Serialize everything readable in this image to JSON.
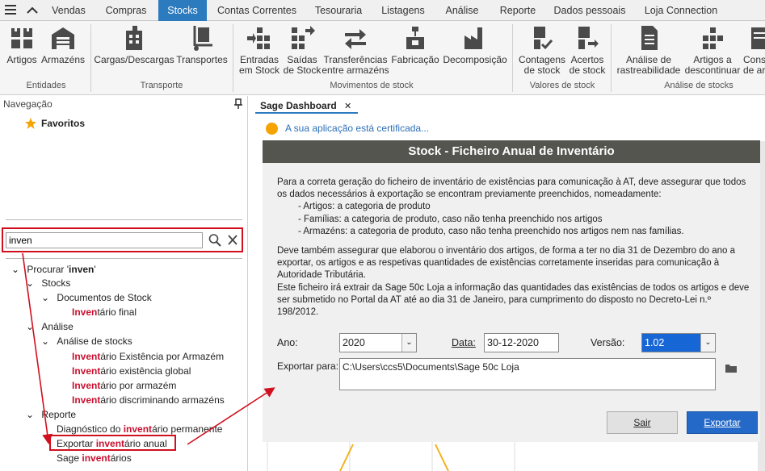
{
  "menu": {
    "tabs": [
      "Vendas",
      "Compras",
      "Stocks",
      "Contas Correntes",
      "Tesouraria",
      "Listagens",
      "Análise",
      "Reporte",
      "Dados pessoais",
      "Loja Connection"
    ],
    "active": "Stocks"
  },
  "ribbon": {
    "buttons": {
      "artigos": "Artigos",
      "armazens": "Armazéns",
      "cargas": "Cargas/Descargas",
      "transportes": "Transportes",
      "entradas_1": "Entradas",
      "entradas_2": "em Stock",
      "saidas_1": "Saídas",
      "saidas_2": "de Stock",
      "transf_1": "Transferências",
      "transf_2": "entre armazéns",
      "fabricacao": "Fabricação",
      "decomposicao": "Decomposição",
      "contagens_1": "Contagens",
      "contagens_2": "de stock",
      "acertos_1": "Acertos",
      "acertos_2": "de stock",
      "analise_1": "Análise de",
      "analise_2": "rastreabilidade",
      "descont_1": "Artigos a",
      "descont_2": "descontinuar",
      "cons_1": "Cons",
      "cons_2": "de ar"
    },
    "groups": {
      "entidades": "Entidades",
      "transporte": "Transporte",
      "movimentos": "Movimentos de stock",
      "valores": "Valores de stock",
      "analise": "Análise de stocks"
    }
  },
  "nav": {
    "header": "Navegação",
    "favoritos": "Favoritos",
    "search_value": "inven",
    "tree": {
      "root_prefix": "Procurar '",
      "root_query": "inven",
      "root_suffix": "'",
      "stocks": "Stocks",
      "doc_stock": "Documentos de Stock",
      "inv_final_hl": "Inven",
      "inv_final_rest": "tário final",
      "analise": "Análise",
      "analise_stocks": "Análise de stocks",
      "inv_exist_arm_hl": "Invent",
      "inv_exist_arm_rest": "ário Existência por Armazém",
      "inv_exist_glob_hl": "Invent",
      "inv_exist_glob_rest": "ário existência global",
      "inv_por_arm_hl": "Invent",
      "inv_por_arm_rest": "ário por armazém",
      "inv_discr_hl": "Invent",
      "inv_discr_rest": "ário discriminando armazéns",
      "reporte": "Reporte",
      "diag_pre": "Diagnóstico do ",
      "diag_hl": "invent",
      "diag_post": "ário permanente",
      "exp_pre": "Exportar ",
      "exp_hl": "invent",
      "exp_post": "ário anual",
      "sage_pre": "Sage ",
      "sage_hl": "invent",
      "sage_post": "ários"
    }
  },
  "doc_tab": {
    "label": "Sage Dashboard",
    "close": "✕"
  },
  "cert_text": "A sua aplicação está certificada...",
  "panel": {
    "title": "Stock - Ficheiro Anual de Inventário",
    "p1": "Para a correta geração do ficheiro de inventário de existências para comunicação à AT, deve assegurar que todos os dados necessários à exportação se encontram previamente preenchidos, nomeadamente:",
    "b1": "- Artigos: a categoria de produto",
    "b2": "- Famílias: a categoria de produto, caso não tenha preenchido nos artigos",
    "b3": "- Armazéns: a categoria de produto, caso não tenha preenchido nos artigos nem nas famílias.",
    "p2": "Deve também assegurar que elaborou o inventário dos artigos, de forma a ter no dia 31 de Dezembro do ano a exportar, os artigos e as respetivas quantidades de existências corretamente inseridas para comunicação à Autoridade Tributária.",
    "p3": "Este ficheiro irá extrair da Sage 50c Loja a informação das quantidades das existências de todos os artigos e deve ser submetido no Portal da AT até ao dia 31 de Janeiro, para cumprimento do disposto no Decreto-Lei n.º 198/2012.",
    "ano_label": "Ano:",
    "ano_value": "2020",
    "data_label": "Data:",
    "data_value": "30-12-2020",
    "versao_label": "Versão:",
    "versao_value": "1.02",
    "export_label": "Exportar para:",
    "export_value": "C:\\Users\\ccs5\\Documents\\Sage 50c Loja",
    "sair": "Sair",
    "exportar": "Exportar"
  },
  "colors": {
    "accent": "#2c7bbf",
    "highlight": "#c8102e",
    "title_bg": "#555550",
    "export_btn": "#2469c7",
    "cert_dot": "#f5a300"
  }
}
